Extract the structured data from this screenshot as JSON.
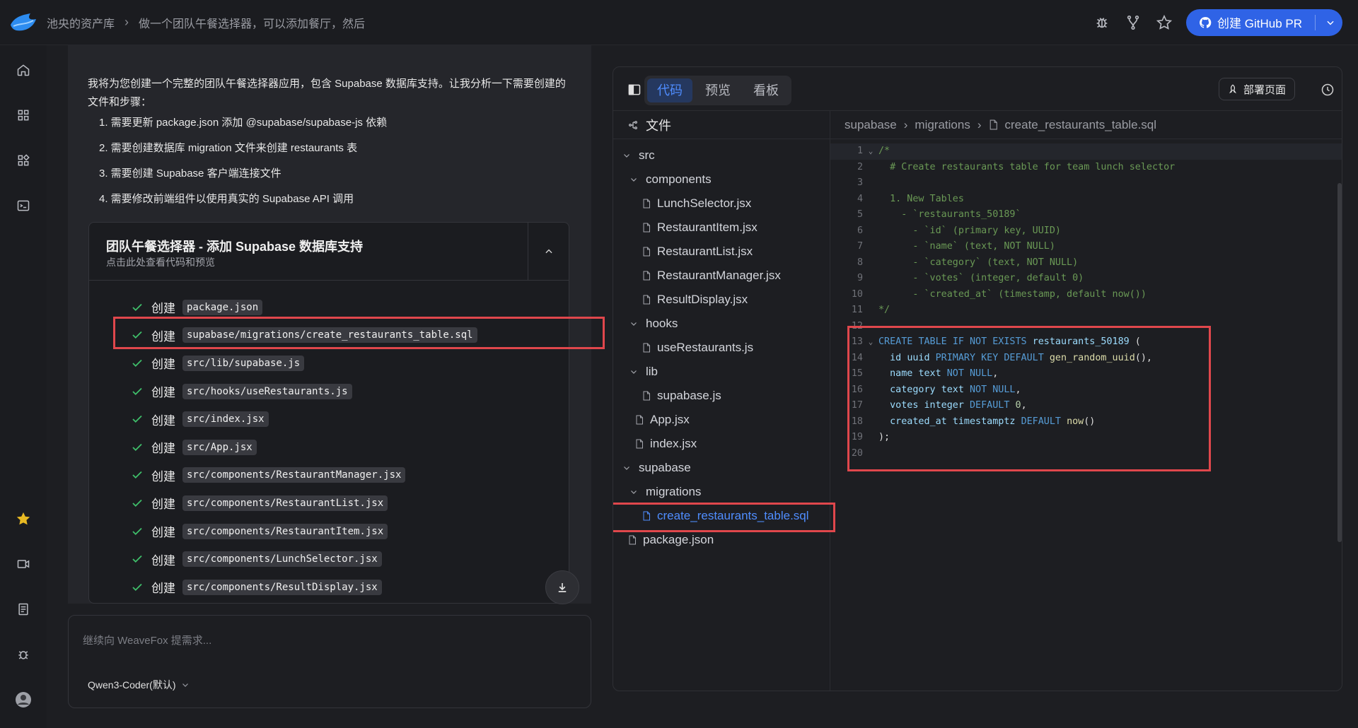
{
  "topbar": {
    "breadcrumbs": [
      "池央的资产库",
      "做一个团队午餐选择器，可以添加餐厅，然后"
    ],
    "pr_button": "创建 GitHub PR"
  },
  "sidebar": {
    "items": [
      "home-icon",
      "grid-icon",
      "apps-icon",
      "terminal-icon",
      "star-icon",
      "video-icon",
      "doc-icon",
      "bug-icon",
      "user-icon"
    ]
  },
  "chat": {
    "intro": "我将为您创建一个完整的团队午餐选择器应用，包含 Supabase 数据库支持。让我分析一下需要创建的文件和步骤：",
    "steps": [
      "1. 需要更新 package.json 添加 @supabase/supabase-js 依赖",
      "2. 需要创建数据库 migration 文件来创建 restaurants 表",
      "3. 需要创建 Supabase 客户端连接文件",
      "4. 需要修改前端组件以使用真实的 Supabase API 调用"
    ],
    "card": {
      "title": "团队午餐选择器 - 添加 Supabase 数据库支持",
      "subtitle": "点击此处查看代码和预览",
      "verb": "创建",
      "files": [
        "package.json",
        "supabase/migrations/create_restaurants_table.sql",
        "src/lib/supabase.js",
        "src/hooks/useRestaurants.js",
        "src/index.jsx",
        "src/App.jsx",
        "src/components/RestaurantManager.jsx",
        "src/components/RestaurantList.jsx",
        "src/components/RestaurantItem.jsx",
        "src/components/LunchSelector.jsx",
        "src/components/ResultDisplay.jsx"
      ]
    },
    "composer": {
      "placeholder": "继续向 WeaveFox 提需求...",
      "model": "Qwen3-Coder(默认)"
    }
  },
  "editor": {
    "tabs": [
      "代码",
      "预览",
      "看板"
    ],
    "active_tab": "代码",
    "deploy_label": "部署页面",
    "tree_title": "文件",
    "tree": [
      {
        "label": "src",
        "depth": 0,
        "type": "folder"
      },
      {
        "label": "components",
        "depth": 1,
        "type": "folder"
      },
      {
        "label": "LunchSelector.jsx",
        "depth": 2,
        "type": "file"
      },
      {
        "label": "RestaurantItem.jsx",
        "depth": 2,
        "type": "file"
      },
      {
        "label": "RestaurantList.jsx",
        "depth": 2,
        "type": "file"
      },
      {
        "label": "RestaurantManager.jsx",
        "depth": 2,
        "type": "file"
      },
      {
        "label": "ResultDisplay.jsx",
        "depth": 2,
        "type": "file"
      },
      {
        "label": "hooks",
        "depth": 1,
        "type": "folder"
      },
      {
        "label": "useRestaurants.js",
        "depth": 2,
        "type": "file"
      },
      {
        "label": "lib",
        "depth": 1,
        "type": "folder"
      },
      {
        "label": "supabase.js",
        "depth": 2,
        "type": "file"
      },
      {
        "label": "App.jsx",
        "depth": 1,
        "type": "file"
      },
      {
        "label": "index.jsx",
        "depth": 1,
        "type": "file"
      },
      {
        "label": "supabase",
        "depth": 0,
        "type": "folder"
      },
      {
        "label": "migrations",
        "depth": 1,
        "type": "folder"
      },
      {
        "label": "create_restaurants_table.sql",
        "depth": 2,
        "type": "file",
        "selected": true
      },
      {
        "label": "package.json",
        "depth": 0,
        "type": "file"
      }
    ],
    "path": [
      "supabase",
      "migrations",
      "create_restaurants_table.sql"
    ],
    "code": [
      "/*",
      "  # Create restaurants table for team lunch selector",
      "",
      "  1. New Tables",
      "    - `restaurants_50189`",
      "      - `id` (primary key, UUID)",
      "      - `name` (text, NOT NULL)",
      "      - `category` (text, NOT NULL)",
      "      - `votes` (integer, default 0)",
      "      - `created_at` (timestamp, default now())",
      "*/",
      "",
      "CREATE TABLE IF NOT EXISTS restaurants_50189 (",
      "  id uuid PRIMARY KEY DEFAULT gen_random_uuid(),",
      "  name text NOT NULL,",
      "  category text NOT NULL,",
      "  votes integer DEFAULT 0,",
      "  created_at timestamptz DEFAULT now()",
      ");",
      ""
    ]
  }
}
